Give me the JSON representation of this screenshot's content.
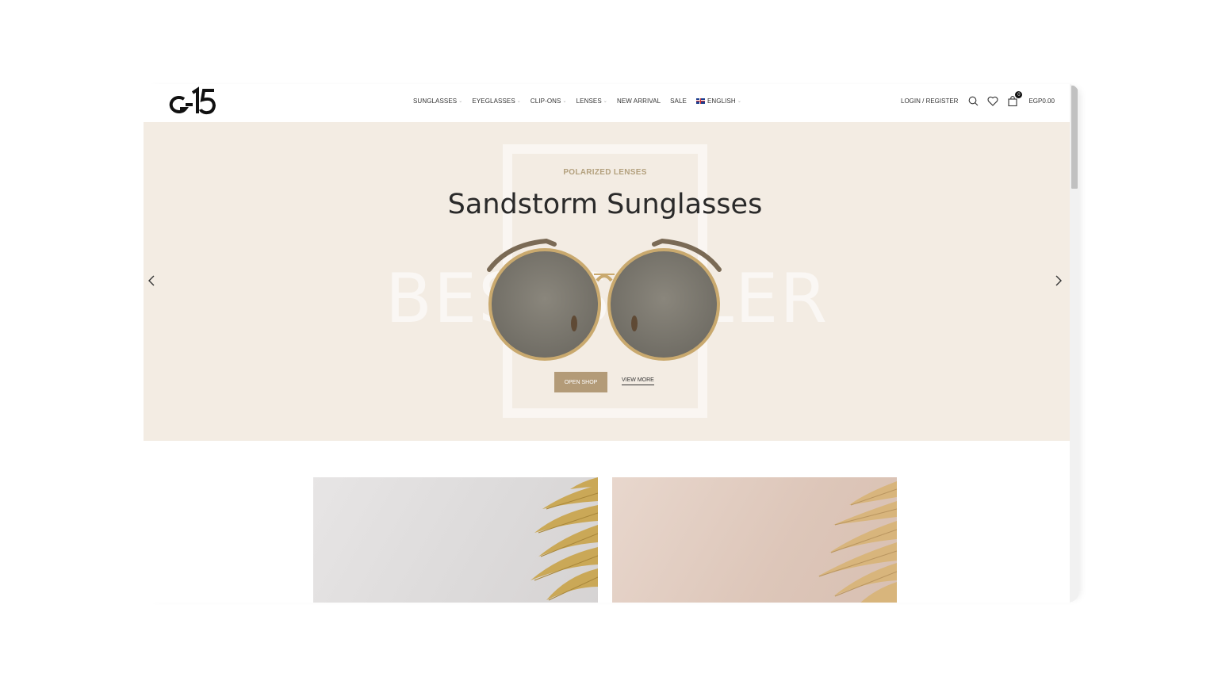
{
  "header": {
    "logo_alt": "G15",
    "nav": [
      {
        "label": "SUNGLASSES",
        "has_dropdown": true
      },
      {
        "label": "EYEGLASSES",
        "has_dropdown": true
      },
      {
        "label": "CLIP-ONS",
        "has_dropdown": true
      },
      {
        "label": "LENSES",
        "has_dropdown": true
      },
      {
        "label": "NEW ARRIVAL",
        "has_dropdown": false
      },
      {
        "label": "SALE",
        "has_dropdown": false
      }
    ],
    "language": {
      "label": "ENGLISH",
      "flag": "uk-flag-icon"
    },
    "login_label": "LOGIN / REGISTER",
    "icons": [
      "search-icon",
      "heart-icon",
      "shopping-bag-icon"
    ],
    "cart": {
      "count": "0",
      "total": "EGP0.00"
    }
  },
  "hero": {
    "subtitle": "POLARIZED LENSES",
    "title": "Sandstorm Sunglasses",
    "background_word": "BESTSELLER",
    "primary_button": "OPEN SHOP",
    "secondary_button": "VIEW MORE",
    "arrows": [
      "chevron-left-icon",
      "chevron-right-icon"
    ]
  },
  "colors": {
    "hero_bg": "#f3ece3",
    "accent": "#b39b78",
    "subtitle": "#b3a07d",
    "title": "#2a2a2a"
  }
}
